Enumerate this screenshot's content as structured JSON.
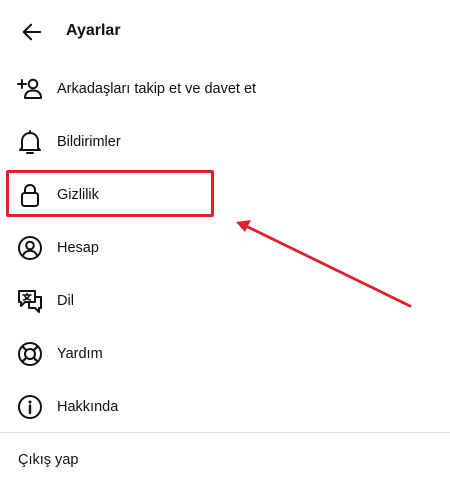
{
  "header": {
    "title": "Ayarlar",
    "back_icon": "arrow-left-icon"
  },
  "menu": {
    "items": [
      {
        "label": "Arkadaşları takip et ve davet et",
        "icon": "person-add-icon"
      },
      {
        "label": "Bildirimler",
        "icon": "bell-icon"
      },
      {
        "label": "Gizlilik",
        "icon": "lock-icon"
      },
      {
        "label": "Hesap",
        "icon": "account-circle-icon"
      },
      {
        "label": "Dil",
        "icon": "translate-icon"
      },
      {
        "label": "Yardım",
        "icon": "lifebuoy-icon"
      },
      {
        "label": "Hakkında",
        "icon": "info-icon"
      }
    ]
  },
  "footer": {
    "logout_label": "Çıkış yap"
  },
  "annotation": {
    "highlight_color": "#e0202a",
    "highlighted_item": "Gizlilik"
  }
}
